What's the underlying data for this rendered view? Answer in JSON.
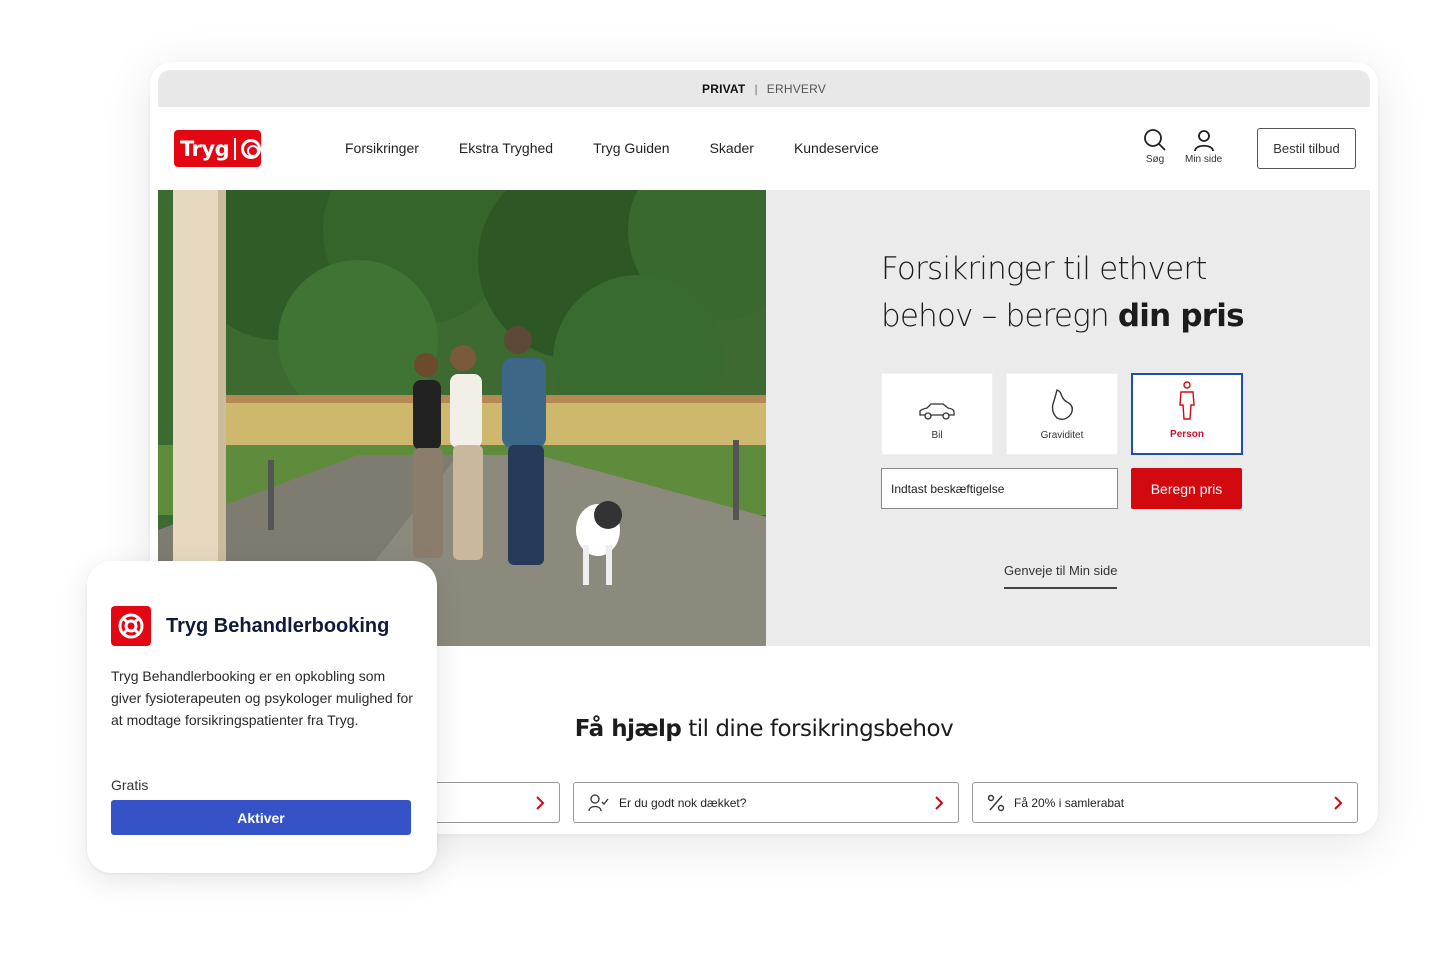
{
  "topbar": {
    "active": "PRIVAT",
    "separator": "|",
    "other": "ERHVERV"
  },
  "header": {
    "logo_text": "Tryg",
    "nav": [
      "Forsikringer",
      "Ekstra Tryghed",
      "Tryg Guiden",
      "Skader",
      "Kundeservice"
    ],
    "search_label": "Søg",
    "account_label": "Min side",
    "cta_label": "Bestil tilbud"
  },
  "hero": {
    "title_line1": "Forsikringer til ethvert",
    "title_line2_pre": "behov – beregn ",
    "title_line2_bold": "din pris",
    "tiles": [
      {
        "label": "Bil",
        "icon": "car-icon",
        "selected": false
      },
      {
        "label": "Graviditet",
        "icon": "pregnancy-icon",
        "selected": true
      },
      {
        "label": "Person",
        "icon": "person-icon",
        "selected": true
      }
    ],
    "occupation_placeholder": "Indtast beskæftigelse",
    "calc_button": "Beregn pris",
    "shortcut_link": "Genveje til Min side"
  },
  "help": {
    "title_bold": "Få hjælp",
    "title_rest": " til dine forsikringsbehov",
    "cards": [
      {
        "label": "",
        "icon": ""
      },
      {
        "label": "Er du godt nok dækket?",
        "icon": "person-check-icon"
      },
      {
        "label": "Få 20% i samlerabat",
        "icon": "percent-icon"
      }
    ]
  },
  "popup": {
    "title": "Tryg Behandlerbooking",
    "description": "Tryg Behandlerbooking er en opkobling som giver fysioterapeuten og psykologer mulighed for at modtage forsikringspatienter fra Tryg.",
    "price": "Gratis",
    "button": "Aktiver"
  },
  "colors": {
    "brand_red": "#d20a10",
    "selected_border": "#1f4db4",
    "popup_button": "#3553c6"
  }
}
